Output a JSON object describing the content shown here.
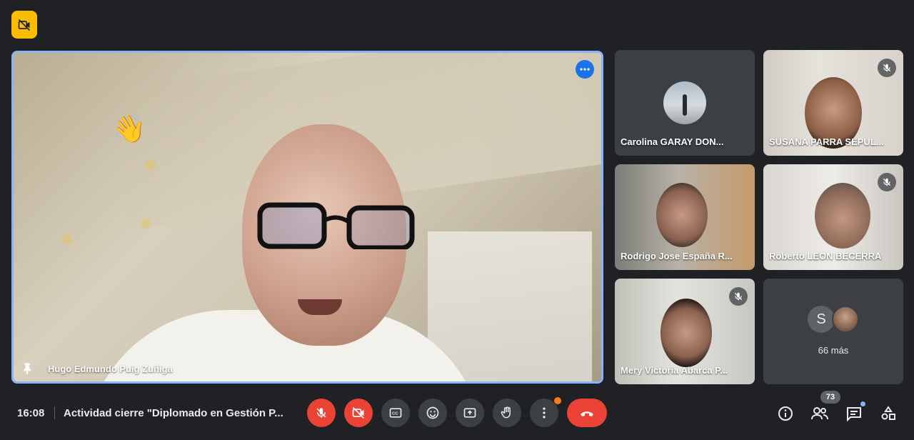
{
  "main": {
    "speaker_name": "Hugo Edmundo Puig Zuñiga",
    "reaction": "👋"
  },
  "tiles": [
    {
      "name": "Carolina GARAY DON...",
      "muted": false
    },
    {
      "name": "SUSANA PARRA SEPUL...",
      "muted": true
    },
    {
      "name": "Rodrigo Jose España R...",
      "muted": false
    },
    {
      "name": "Roberto LEON BECERRA",
      "muted": true
    },
    {
      "name": "Mery Victoria Abarca P...",
      "muted": true
    }
  ],
  "more_tile": {
    "avatar_initial": "S",
    "label": "66 más"
  },
  "bottom": {
    "time": "16:08",
    "title": "Actividad cierre \"Diplomado en Gestión P...",
    "participants_count": "73"
  },
  "icons": {
    "top_badge": "camera-off-icon",
    "controls": [
      "mic-off-icon",
      "camera-off-icon",
      "captions-icon",
      "emoji-icon",
      "present-icon",
      "raise-hand-icon",
      "more-options-icon",
      "hang-up-icon"
    ],
    "right": [
      "info-icon",
      "people-icon",
      "chat-icon",
      "activities-icon"
    ]
  },
  "colors": {
    "accent": "#8ab4f8",
    "danger": "#ea4335",
    "badge": "#fbbc04",
    "background": "#202124"
  }
}
